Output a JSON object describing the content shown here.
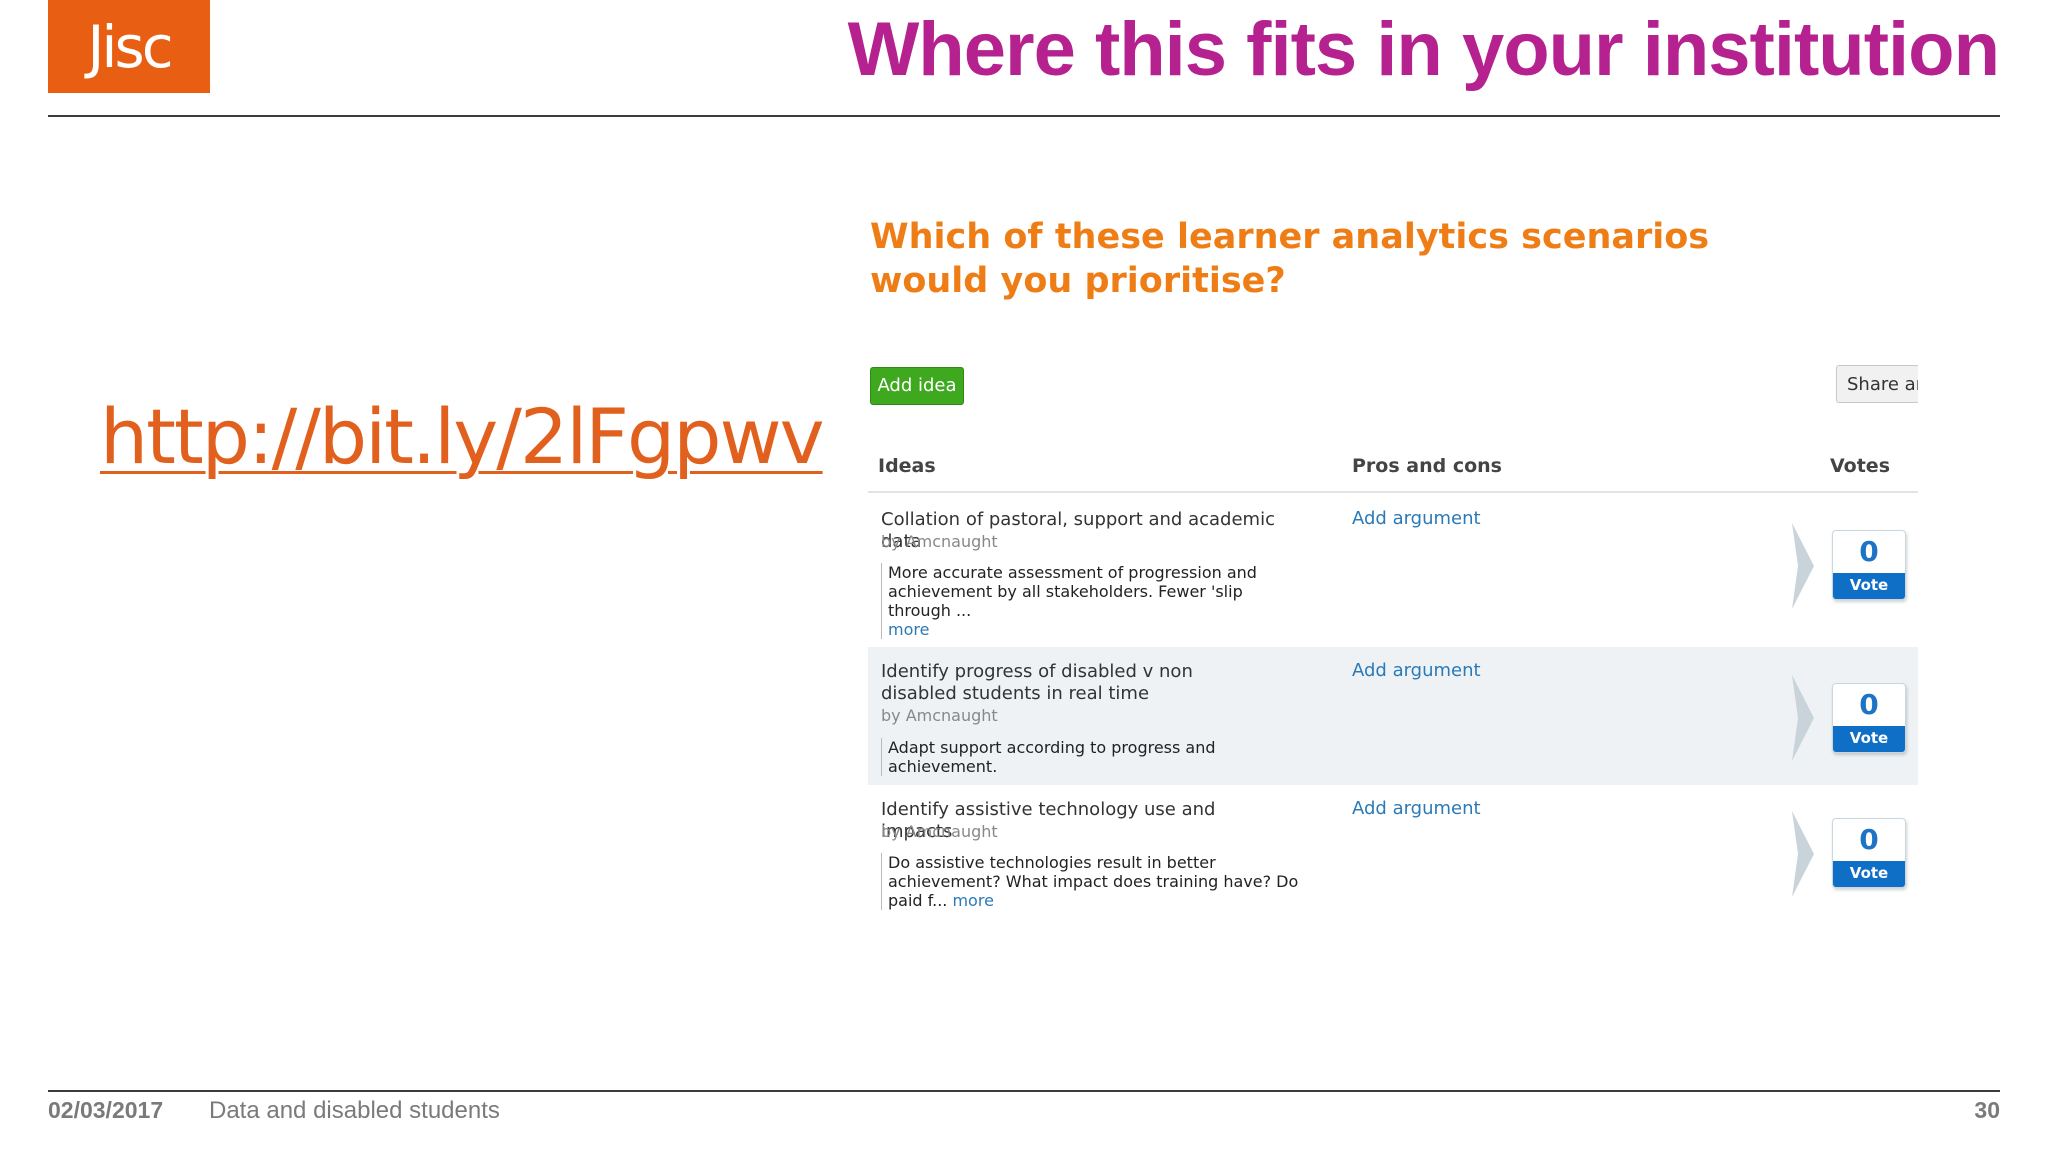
{
  "slide": {
    "logo": "Jisc",
    "title": "Where this fits in your institution",
    "link": "http://bit.ly/2lFgpwv",
    "footer": {
      "date": "02/03/2017",
      "text": "Data and disabled students",
      "page": "30"
    }
  },
  "embed": {
    "question": "Which of these learner analytics scenarios would you prioritise?",
    "add_idea_label": "Add idea",
    "share_label": "Share an",
    "columns": {
      "ideas": "Ideas",
      "pros_cons": "Pros and cons",
      "votes": "Votes"
    },
    "ideas": [
      {
        "title": "Collation of pastoral, support and academic data",
        "author": "by Amcnaught",
        "description": "More accurate assessment of progression and achievement by all stakeholders. Fewer 'slip through ...",
        "more": "more",
        "argument_link": "Add argument",
        "votes": "0",
        "vote_label": "Vote"
      },
      {
        "title": "Identify progress of disabled v non disabled students in real time",
        "author": "by Amcnaught",
        "description": "Adapt support according to progress and achievement.",
        "more": "",
        "argument_link": "Add argument",
        "votes": "0",
        "vote_label": "Vote"
      },
      {
        "title": "Identify assistive technology use and impacts",
        "author": "by Amcnaught",
        "description": "Do assistive technologies result in better achievement? What impact does training have? Do paid f...",
        "more": "more",
        "argument_link": "Add argument",
        "votes": "0",
        "vote_label": "Vote"
      }
    ]
  },
  "colors": {
    "brand": "#e85e13",
    "title": "#b5218e",
    "link": "#e2601e",
    "question": "#ef7d16",
    "add_idea": "#3ea91f",
    "vote": "#0f6ec5"
  }
}
